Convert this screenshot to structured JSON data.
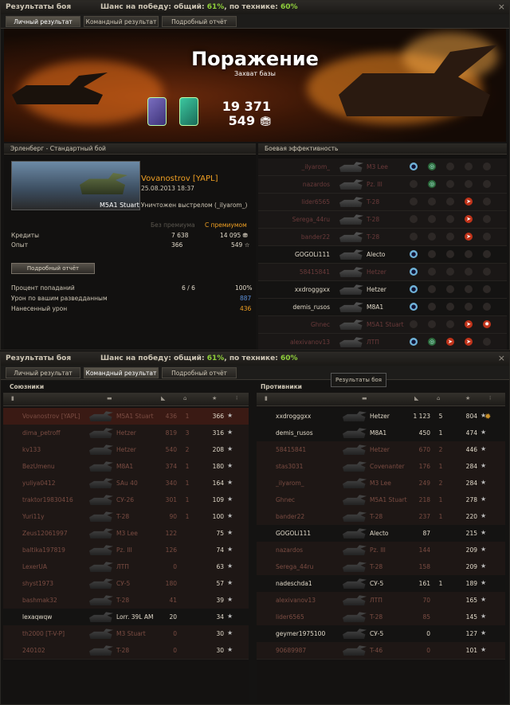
{
  "window1": {
    "title": "Результаты боя",
    "chance_label": "Шанс на победу: общий:",
    "chance_total": "61%",
    "chance_mid": ", по технике:",
    "chance_tech": "60%",
    "close": "×",
    "tabs": [
      "Личный результат",
      "Командный результат",
      "Подробный отчёт"
    ],
    "banner": {
      "result": "Поражение",
      "subtitle": "Захват базы",
      "credits": "19 371",
      "exp": "549"
    },
    "left": {
      "header": "Эрленберг - Стандартный бой",
      "player": "Vovanostrov [YAPL]",
      "date": "25.08.2013 18:37",
      "tank": "M5A1 Stuart",
      "killed_by": "Уничтожен выстрелом (_ilyarom_)",
      "col_base": "Без премиума",
      "col_prem": "С премиумом",
      "credits_label": "Кредиты",
      "credits_base": "7 638",
      "credits_prem": "14 095",
      "exp_label": "Опыт",
      "exp_base": "366",
      "exp_prem": "549",
      "detail_button": "Подробный отчёт",
      "hit_label": "Процент попаданий",
      "hit_shots": "6 / 6",
      "hit_pct": "100%",
      "spot_label": "Урон по вашим разведданным",
      "spot_val": "887",
      "dmg_label": "Нанесенный урон",
      "dmg_val": "436"
    },
    "right": {
      "header": "Боевая эффективность",
      "rows": [
        {
          "name": "_ilyarom_",
          "tank": "M3 Lee"
        },
        {
          "name": "nazardos",
          "tank": "Pz. III"
        },
        {
          "name": "lider6565",
          "tank": "T-28"
        },
        {
          "name": "Serega_44ru",
          "tank": "T-28"
        },
        {
          "name": "bander22",
          "tank": "T-28"
        },
        {
          "name": "GOGOLi111",
          "tank": "Alecto"
        },
        {
          "name": "58415841",
          "tank": "Hetzer"
        },
        {
          "name": "xxdrogggxx",
          "tank": "Hetzer"
        },
        {
          "name": "demis_rusos",
          "tank": "M8A1"
        },
        {
          "name": "Ghnec",
          "tank": "M5A1 Stuart"
        },
        {
          "name": "alexivanov13",
          "tank": "ЛТП"
        }
      ]
    }
  },
  "window2": {
    "title": "Результаты боя",
    "chance_label": "Шанс на победу: общий:",
    "chance_total": "61%",
    "chance_mid": ", по технике:",
    "chance_tech": "60%",
    "close": "×",
    "tabs": [
      "Личный результат",
      "Командный результат",
      "Подробный отчёт"
    ],
    "tooltip": "Результаты боя",
    "allies_title": "Союзники",
    "enemies_title": "Противники",
    "allies": [
      {
        "name": "Vovanostrov [YAPL]",
        "tank": "M5A1 Stuart",
        "dmg": "436",
        "kills": "1",
        "xp": "366"
      },
      {
        "name": "dima_petroff",
        "tank": "Hetzer",
        "dmg": "819",
        "kills": "3",
        "xp": "316"
      },
      {
        "name": "kv133",
        "tank": "Hetzer",
        "dmg": "540",
        "kills": "2",
        "xp": "208"
      },
      {
        "name": "BezUmenu",
        "tank": "M8A1",
        "dmg": "374",
        "kills": "1",
        "xp": "180"
      },
      {
        "name": "yuliya0412",
        "tank": "SAu 40",
        "dmg": "340",
        "kills": "1",
        "xp": "164"
      },
      {
        "name": "traktor19830416",
        "tank": "СУ-26",
        "dmg": "301",
        "kills": "1",
        "xp": "109"
      },
      {
        "name": "Yuri11y",
        "tank": "T-28",
        "dmg": "90",
        "kills": "1",
        "xp": "100"
      },
      {
        "name": "Zeus12061997",
        "tank": "M3 Lee",
        "dmg": "122",
        "kills": "",
        "xp": "75"
      },
      {
        "name": "baltika197819",
        "tank": "Pz. III",
        "dmg": "126",
        "kills": "",
        "xp": "74"
      },
      {
        "name": "LexerUA",
        "tank": "ЛТП",
        "dmg": "0",
        "kills": "",
        "xp": "63"
      },
      {
        "name": "shyst1973",
        "tank": "СУ-5",
        "dmg": "180",
        "kills": "",
        "xp": "57"
      },
      {
        "name": "bashmak32",
        "tank": "T-28",
        "dmg": "41",
        "kills": "",
        "xp": "39"
      },
      {
        "name": "lexaqwqw",
        "tank": "Lorr. 39L AM",
        "dmg": "20",
        "kills": "",
        "xp": "34"
      },
      {
        "name": "th2000 [T-V-P]",
        "tank": "M3 Stuart",
        "dmg": "0",
        "kills": "",
        "xp": "30"
      },
      {
        "name": "240102",
        "tank": "T-28",
        "dmg": "0",
        "kills": "",
        "xp": "30"
      }
    ],
    "enemies": [
      {
        "name": "xxdrogggxx",
        "tank": "Hetzer",
        "dmg": "1 123",
        "kills": "5",
        "xp": "804"
      },
      {
        "name": "demis_rusos",
        "tank": "M8A1",
        "dmg": "450",
        "kills": "1",
        "xp": "474"
      },
      {
        "name": "58415841",
        "tank": "Hetzer",
        "dmg": "670",
        "kills": "2",
        "xp": "446"
      },
      {
        "name": "stas3031",
        "tank": "Covenanter",
        "dmg": "176",
        "kills": "1",
        "xp": "284"
      },
      {
        "name": "_ilyarom_",
        "tank": "M3 Lee",
        "dmg": "249",
        "kills": "2",
        "xp": "284"
      },
      {
        "name": "Ghnec",
        "tank": "M5A1 Stuart",
        "dmg": "218",
        "kills": "1",
        "xp": "278"
      },
      {
        "name": "bander22",
        "tank": "T-28",
        "dmg": "237",
        "kills": "1",
        "xp": "220"
      },
      {
        "name": "GOGOLi111",
        "tank": "Alecto",
        "dmg": "87",
        "kills": "",
        "xp": "215"
      },
      {
        "name": "nazardos",
        "tank": "Pz. III",
        "dmg": "144",
        "kills": "",
        "xp": "209"
      },
      {
        "name": "Serega_44ru",
        "tank": "T-28",
        "dmg": "158",
        "kills": "",
        "xp": "209"
      },
      {
        "name": "nadeschda1",
        "tank": "СУ-5",
        "dmg": "161",
        "kills": "1",
        "xp": "189"
      },
      {
        "name": "alexivanov13",
        "tank": "ЛТП",
        "dmg": "70",
        "kills": "",
        "xp": "165"
      },
      {
        "name": "lider6565",
        "tank": "T-28",
        "dmg": "85",
        "kills": "",
        "xp": "145"
      },
      {
        "name": "geymer1975100",
        "tank": "СУ-5",
        "dmg": "0",
        "kills": "",
        "xp": "127"
      },
      {
        "name": "90689987",
        "tank": "T-46",
        "dmg": "0",
        "kills": "",
        "xp": "101"
      }
    ]
  }
}
